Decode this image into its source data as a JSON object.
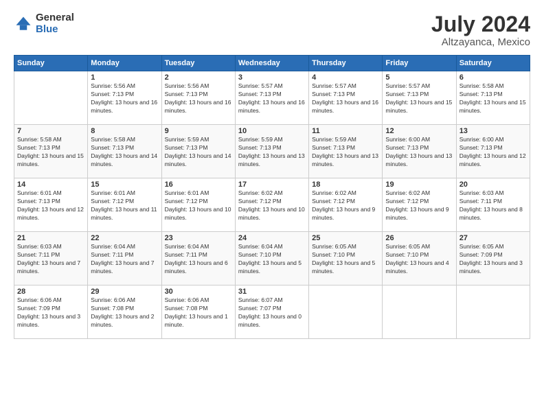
{
  "logo": {
    "general": "General",
    "blue": "Blue"
  },
  "header": {
    "month": "July 2024",
    "location": "Altzayanca, Mexico"
  },
  "weekdays": [
    "Sunday",
    "Monday",
    "Tuesday",
    "Wednesday",
    "Thursday",
    "Friday",
    "Saturday"
  ],
  "weeks": [
    [
      {
        "day": null,
        "sunrise": null,
        "sunset": null,
        "daylight": null
      },
      {
        "day": "1",
        "sunrise": "Sunrise: 5:56 AM",
        "sunset": "Sunset: 7:13 PM",
        "daylight": "Daylight: 13 hours and 16 minutes."
      },
      {
        "day": "2",
        "sunrise": "Sunrise: 5:56 AM",
        "sunset": "Sunset: 7:13 PM",
        "daylight": "Daylight: 13 hours and 16 minutes."
      },
      {
        "day": "3",
        "sunrise": "Sunrise: 5:57 AM",
        "sunset": "Sunset: 7:13 PM",
        "daylight": "Daylight: 13 hours and 16 minutes."
      },
      {
        "day": "4",
        "sunrise": "Sunrise: 5:57 AM",
        "sunset": "Sunset: 7:13 PM",
        "daylight": "Daylight: 13 hours and 16 minutes."
      },
      {
        "day": "5",
        "sunrise": "Sunrise: 5:57 AM",
        "sunset": "Sunset: 7:13 PM",
        "daylight": "Daylight: 13 hours and 15 minutes."
      },
      {
        "day": "6",
        "sunrise": "Sunrise: 5:58 AM",
        "sunset": "Sunset: 7:13 PM",
        "daylight": "Daylight: 13 hours and 15 minutes."
      }
    ],
    [
      {
        "day": "7",
        "sunrise": "Sunrise: 5:58 AM",
        "sunset": "Sunset: 7:13 PM",
        "daylight": "Daylight: 13 hours and 15 minutes."
      },
      {
        "day": "8",
        "sunrise": "Sunrise: 5:58 AM",
        "sunset": "Sunset: 7:13 PM",
        "daylight": "Daylight: 13 hours and 14 minutes."
      },
      {
        "day": "9",
        "sunrise": "Sunrise: 5:59 AM",
        "sunset": "Sunset: 7:13 PM",
        "daylight": "Daylight: 13 hours and 14 minutes."
      },
      {
        "day": "10",
        "sunrise": "Sunrise: 5:59 AM",
        "sunset": "Sunset: 7:13 PM",
        "daylight": "Daylight: 13 hours and 13 minutes."
      },
      {
        "day": "11",
        "sunrise": "Sunrise: 5:59 AM",
        "sunset": "Sunset: 7:13 PM",
        "daylight": "Daylight: 13 hours and 13 minutes."
      },
      {
        "day": "12",
        "sunrise": "Sunrise: 6:00 AM",
        "sunset": "Sunset: 7:13 PM",
        "daylight": "Daylight: 13 hours and 13 minutes."
      },
      {
        "day": "13",
        "sunrise": "Sunrise: 6:00 AM",
        "sunset": "Sunset: 7:13 PM",
        "daylight": "Daylight: 13 hours and 12 minutes."
      }
    ],
    [
      {
        "day": "14",
        "sunrise": "Sunrise: 6:01 AM",
        "sunset": "Sunset: 7:13 PM",
        "daylight": "Daylight: 13 hours and 12 minutes."
      },
      {
        "day": "15",
        "sunrise": "Sunrise: 6:01 AM",
        "sunset": "Sunset: 7:12 PM",
        "daylight": "Daylight: 13 hours and 11 minutes."
      },
      {
        "day": "16",
        "sunrise": "Sunrise: 6:01 AM",
        "sunset": "Sunset: 7:12 PM",
        "daylight": "Daylight: 13 hours and 10 minutes."
      },
      {
        "day": "17",
        "sunrise": "Sunrise: 6:02 AM",
        "sunset": "Sunset: 7:12 PM",
        "daylight": "Daylight: 13 hours and 10 minutes."
      },
      {
        "day": "18",
        "sunrise": "Sunrise: 6:02 AM",
        "sunset": "Sunset: 7:12 PM",
        "daylight": "Daylight: 13 hours and 9 minutes."
      },
      {
        "day": "19",
        "sunrise": "Sunrise: 6:02 AM",
        "sunset": "Sunset: 7:12 PM",
        "daylight": "Daylight: 13 hours and 9 minutes."
      },
      {
        "day": "20",
        "sunrise": "Sunrise: 6:03 AM",
        "sunset": "Sunset: 7:11 PM",
        "daylight": "Daylight: 13 hours and 8 minutes."
      }
    ],
    [
      {
        "day": "21",
        "sunrise": "Sunrise: 6:03 AM",
        "sunset": "Sunset: 7:11 PM",
        "daylight": "Daylight: 13 hours and 7 minutes."
      },
      {
        "day": "22",
        "sunrise": "Sunrise: 6:04 AM",
        "sunset": "Sunset: 7:11 PM",
        "daylight": "Daylight: 13 hours and 7 minutes."
      },
      {
        "day": "23",
        "sunrise": "Sunrise: 6:04 AM",
        "sunset": "Sunset: 7:11 PM",
        "daylight": "Daylight: 13 hours and 6 minutes."
      },
      {
        "day": "24",
        "sunrise": "Sunrise: 6:04 AM",
        "sunset": "Sunset: 7:10 PM",
        "daylight": "Daylight: 13 hours and 5 minutes."
      },
      {
        "day": "25",
        "sunrise": "Sunrise: 6:05 AM",
        "sunset": "Sunset: 7:10 PM",
        "daylight": "Daylight: 13 hours and 5 minutes."
      },
      {
        "day": "26",
        "sunrise": "Sunrise: 6:05 AM",
        "sunset": "Sunset: 7:10 PM",
        "daylight": "Daylight: 13 hours and 4 minutes."
      },
      {
        "day": "27",
        "sunrise": "Sunrise: 6:05 AM",
        "sunset": "Sunset: 7:09 PM",
        "daylight": "Daylight: 13 hours and 3 minutes."
      }
    ],
    [
      {
        "day": "28",
        "sunrise": "Sunrise: 6:06 AM",
        "sunset": "Sunset: 7:09 PM",
        "daylight": "Daylight: 13 hours and 3 minutes."
      },
      {
        "day": "29",
        "sunrise": "Sunrise: 6:06 AM",
        "sunset": "Sunset: 7:08 PM",
        "daylight": "Daylight: 13 hours and 2 minutes."
      },
      {
        "day": "30",
        "sunrise": "Sunrise: 6:06 AM",
        "sunset": "Sunset: 7:08 PM",
        "daylight": "Daylight: 13 hours and 1 minute."
      },
      {
        "day": "31",
        "sunrise": "Sunrise: 6:07 AM",
        "sunset": "Sunset: 7:07 PM",
        "daylight": "Daylight: 13 hours and 0 minutes."
      },
      {
        "day": null,
        "sunrise": null,
        "sunset": null,
        "daylight": null
      },
      {
        "day": null,
        "sunrise": null,
        "sunset": null,
        "daylight": null
      },
      {
        "day": null,
        "sunrise": null,
        "sunset": null,
        "daylight": null
      }
    ]
  ]
}
